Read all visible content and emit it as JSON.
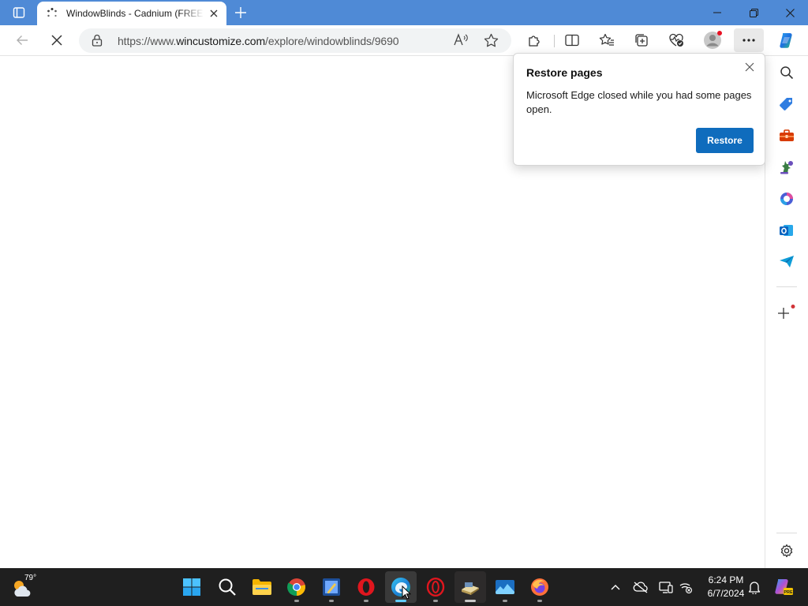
{
  "browser": {
    "tab_title": "WindowBlinds - Cadnium (FREE Edition)",
    "url_prefix": "https://www.",
    "url_domain": "wincustomize.com",
    "url_path": "/explore/windowblinds/9690"
  },
  "popup": {
    "title": "Restore pages",
    "message": "Microsoft Edge closed while you had some pages open.",
    "restore_label": "Restore"
  },
  "taskbar": {
    "weather_temp": "79°",
    "time": "6:24 PM",
    "date": "6/7/2024"
  },
  "colors": {
    "titlebar": "#4f8ad6",
    "accent_button": "#0f6cbd",
    "taskbar": "#1f1f1f"
  },
  "icons": [
    "tab-actions-icon",
    "loading-spinner-icon",
    "tab-close-icon",
    "new-tab-icon",
    "minimize-icon",
    "restore-icon",
    "close-icon",
    "back-icon",
    "stop-icon",
    "lock-icon",
    "read-aloud-icon",
    "favorite-star-icon",
    "extensions-icon",
    "split-screen-icon",
    "favorites-icon",
    "collections-icon",
    "browser-essentials-icon",
    "profile-icon",
    "more-icon",
    "copilot-icon",
    "search-icon",
    "shopping-icon",
    "tools-icon",
    "games-icon",
    "microsoft365-icon",
    "outlook-icon",
    "drop-icon",
    "add-icon",
    "settings-icon",
    "windows-start-icon",
    "chrome-icon",
    "file-explorer-icon",
    "opera-icon",
    "edge-icon",
    "firefox-icon",
    "show-hidden-icons-icon",
    "network-icon",
    "notification-bell-icon"
  ]
}
